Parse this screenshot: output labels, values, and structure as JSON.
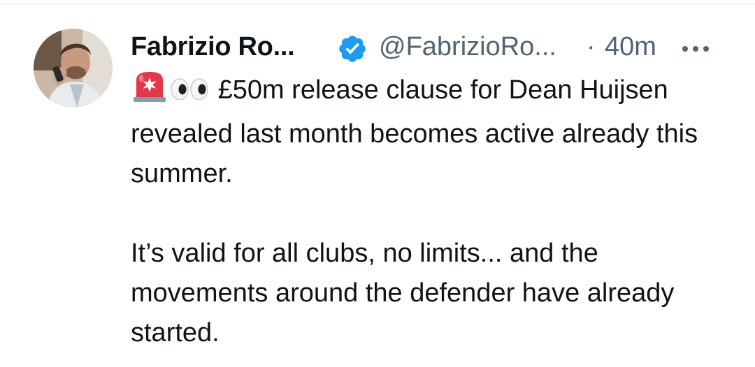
{
  "tweet": {
    "author": {
      "display_name": "Fabrizio Ro...",
      "verified": true,
      "handle": "@FabrizioRo...",
      "avatar_icon": "profile-photo"
    },
    "separator": "·",
    "time_ago": "40m",
    "more_icon": "more-options-icon",
    "emojis": [
      "rotating-light-emoji",
      "eyes-emoji"
    ],
    "text_line_1": "£50m release clause for Dean Huijsen revealed last month becomes active already this summer.",
    "text_line_2": "It’s valid for all clubs, no limits... and the movements around the defender have already started."
  },
  "colors": {
    "text_primary": "#0f1419",
    "text_secondary": "#536471",
    "verified_blue": "#1d9bf0",
    "divider": "#eff3f4"
  }
}
